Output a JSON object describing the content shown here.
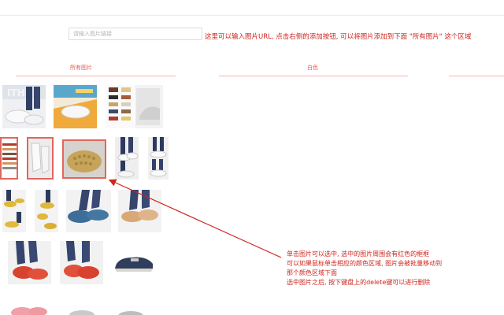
{
  "url_input": {
    "placeholder": "请输入图片链接",
    "value": ""
  },
  "top_note": "这里可以输入图片URL, 点击右侧的添加按钮, 可以将图片添加到下面 \"所有图片\" 这个区域",
  "categories": [
    {
      "label": "所有图片"
    },
    {
      "label": "白色"
    },
    {
      "label": ""
    }
  ],
  "instructions": [
    "单击图片可以选中, 选中的图片周围会有红色的框框",
    "可以如果鼠标单击相应的颜色区域, 图片会被批量移动到",
    "那个颜色区域下面",
    "选中图片之后, 按下键盘上的delete键可以进行删除"
  ],
  "colors": {
    "accent_red": "#d0241c",
    "selected_border": "#e2665c",
    "divider": "#f2b3ae"
  },
  "thumbnails": [
    {
      "icon": "shoe-banner-white",
      "selected": false
    },
    {
      "icon": "shoe-promo-orange",
      "selected": false
    },
    {
      "icon": "shoe-color-chart",
      "selected": false
    },
    {
      "icon": "shoe-white-side",
      "selected": false
    },
    {
      "icon": "shoe-size-chart",
      "selected": true
    },
    {
      "icon": "shoe-white-pair",
      "selected": true
    },
    {
      "icon": "shoe-sole-closeup",
      "selected": true
    },
    {
      "icon": "shoe-white-on-feet",
      "selected": false
    },
    {
      "icon": "shoe-white-on-feet-2",
      "selected": false
    },
    {
      "icon": "shoe-yellow-grid",
      "selected": false
    },
    {
      "icon": "shoe-yellow-grid-2",
      "selected": false
    },
    {
      "icon": "shoe-blue-on-feet",
      "selected": false
    },
    {
      "icon": "shoe-yellow-on-feet",
      "selected": false
    },
    {
      "icon": "shoe-red-on-feet",
      "selected": false
    },
    {
      "icon": "shoe-red-pair",
      "selected": false
    },
    {
      "icon": "shoe-navy-loafer",
      "selected": false
    },
    {
      "icon": "shoe-pink-pair",
      "selected": false
    },
    {
      "icon": "shoe-grey-pair",
      "selected": false
    },
    {
      "icon": "shoe-grey-pair-2",
      "selected": false
    }
  ]
}
